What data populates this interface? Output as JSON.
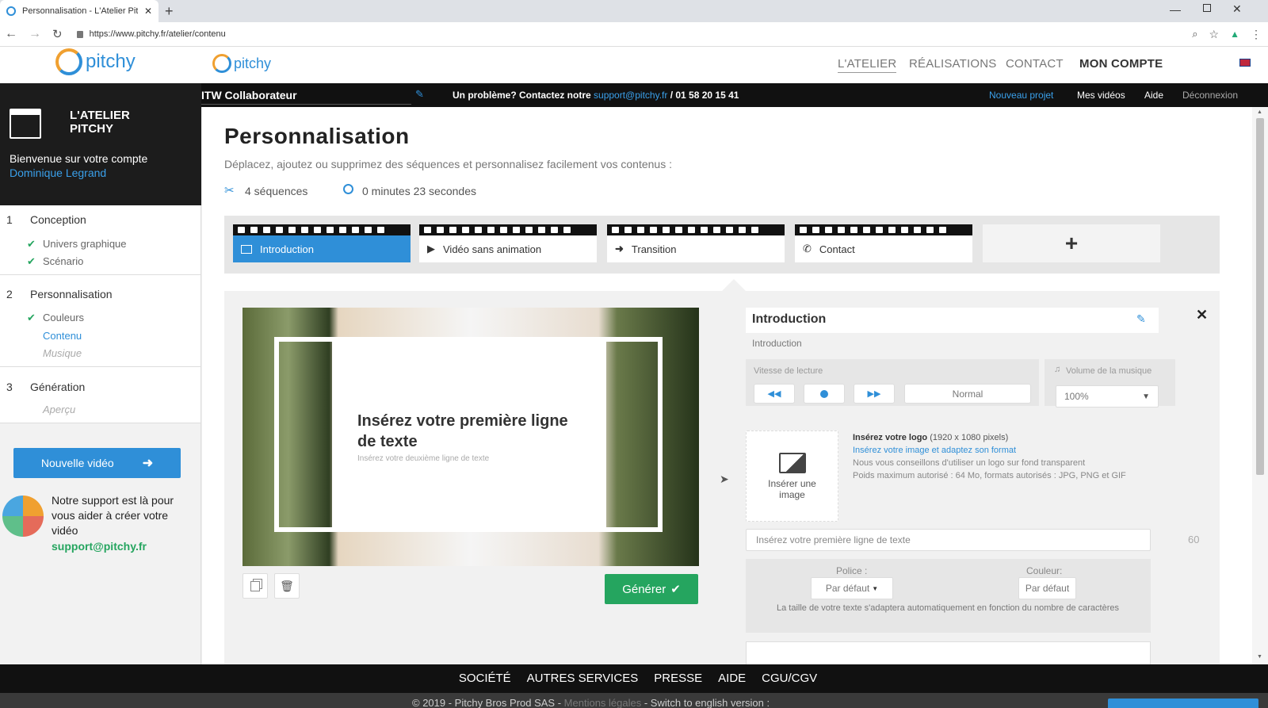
{
  "browser": {
    "tab_title": "Personnalisation - L'Atelier Pitchy",
    "url": "https://www.pitchy.fr/atelier/contenu"
  },
  "site_header": {
    "logo_text": "pitchy",
    "logo_text_2": "pitchy",
    "nav": [
      "L'ATELIER",
      "RÉALISATIONS",
      "CONTACT",
      "MON COMPTE"
    ]
  },
  "blackbar": {
    "project_name": "ITW Collaborateur",
    "help_prefix": "Un problème? Contactez notre",
    "help_email": "support@pitchy.fr",
    "help_phone": "/ 01 58 20 15 41",
    "links": [
      "Nouveau projet",
      "Mes vidéos",
      "Aide",
      "Déconnexion"
    ]
  },
  "sidebar": {
    "brand_line1": "L'ATELIER",
    "brand_line2": "PITCHY",
    "welcome": "Bienvenue sur votre compte",
    "user": "Dominique Legrand",
    "steps": [
      {
        "num": "1",
        "label": "Conception",
        "subs": [
          "Univers graphique",
          "Scénario"
        ]
      },
      {
        "num": "2",
        "label": "Personnalisation",
        "subs": [
          "Couleurs",
          "Contenu",
          "Musique"
        ]
      },
      {
        "num": "3",
        "label": "Génération",
        "subs": [
          "Aperçu"
        ]
      }
    ],
    "new_video": "Nouvelle vidéo",
    "support_text": "Notre support est là pour vous aider à créer votre vidéo",
    "support_email": "support@pitchy.fr"
  },
  "main": {
    "title": "Personnalisation",
    "subtitle": "Déplacez, ajoutez ou supprimez des séquences et personnalisez facilement vos contenus :",
    "seq_count": "4 séquences",
    "duration": "0 minutes 23 secondes",
    "sequences": [
      "Introduction",
      "Vidéo sans animation",
      "Transition",
      "Contact"
    ],
    "add_label": "+",
    "preview_line1": "Insérez votre première ligne de texte",
    "preview_line2": "Insérez votre deuxième ligne de texte",
    "generate": "Générer"
  },
  "editor": {
    "title": "Introduction",
    "subtitle": "Introduction",
    "speed_label": "Vitesse de lecture",
    "speed_value": "Normal",
    "volume_label": "Volume de la musique",
    "volume_value": "100%",
    "logo_title": "Insérez votre logo",
    "logo_dims": "(1920 x 1080 pixels)",
    "logo_link": "Insérez votre image et adaptez son format",
    "logo_note1": "Nous vous conseillons d'utiliser un logo sur fond transparent",
    "logo_note2": "Poids maximum autorisé : 64 Mo, formats autorisés : JPG, PNG et GIF",
    "insert_image": "Insérer une image",
    "text1_placeholder": "Insérez votre première ligne de texte",
    "char_count": "60",
    "font_label": "Police :",
    "font_value": "Par défaut",
    "color_label": "Couleur:",
    "color_value": "Par défaut",
    "autosize_note": "La taille de votre texte s'adaptera automatiquement en fonction du nombre de caractères"
  },
  "footer": {
    "links": [
      "SOCIÉTÉ",
      "AUTRES SERVICES",
      "PRESSE",
      "AIDE",
      "CGU/CGV"
    ],
    "copyright": "© 2019 - Pitchy Bros Prod SAS -",
    "legal": "Mentions légales",
    "switch": "- Switch to english version :"
  },
  "colors": {
    "accent_blue": "#2f8fd8",
    "green": "#25a55f",
    "black": "#111111"
  }
}
